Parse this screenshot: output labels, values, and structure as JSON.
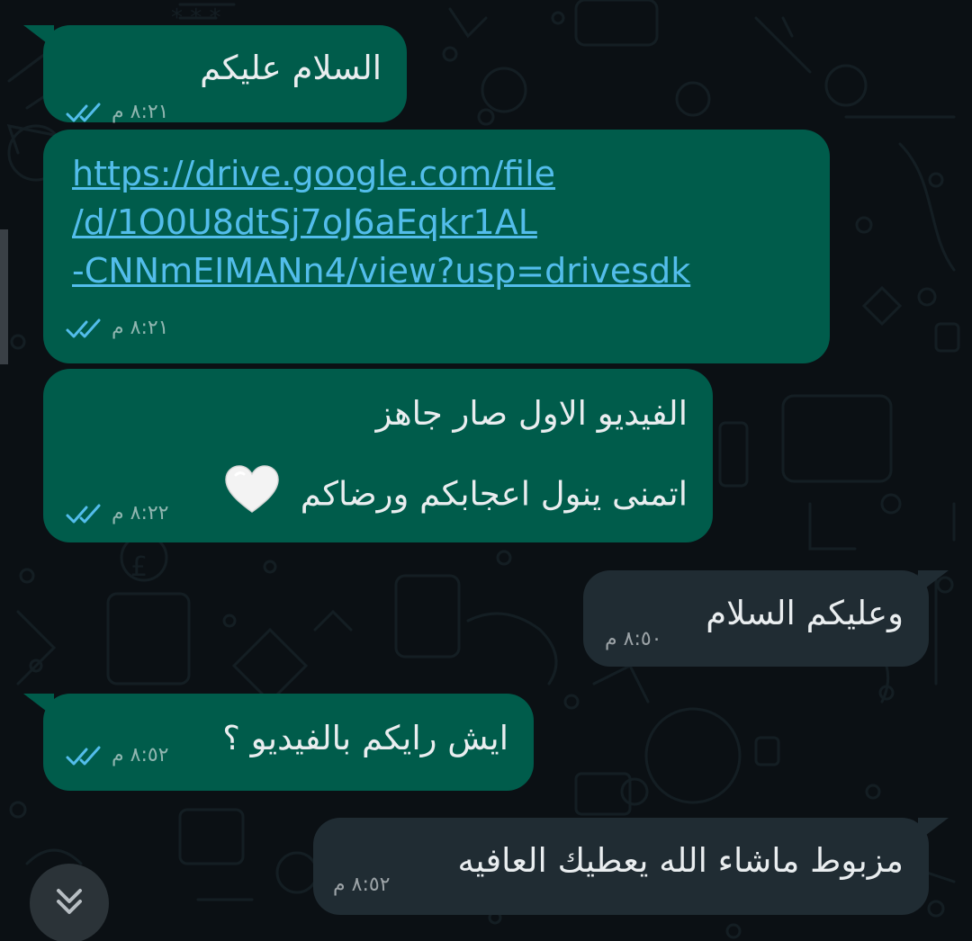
{
  "messages": [
    {
      "id": "m1",
      "direction": "outgoing",
      "text": "السلام عليكم",
      "time": "٨:٢١ م",
      "status": "read"
    },
    {
      "id": "m2",
      "direction": "outgoing",
      "link_lines": [
        "https://drive.google.com/file",
        "/d/1O0U8dtSj7oJ6aEqkr1AL",
        "-CNNmEIMANn4/view?usp=drivesdk"
      ],
      "time": "٨:٢١ م",
      "status": "read"
    },
    {
      "id": "m3",
      "direction": "outgoing",
      "lines": [
        "الفيديو الاول صار جاهز",
        "اتمنى ينول اعجابكم ورضاكم"
      ],
      "emoji": "white-heart",
      "time": "٨:٢٢ م",
      "status": "read"
    },
    {
      "id": "m4",
      "direction": "incoming",
      "text": "وعليكم السلام",
      "time": "٨:٥٠ م"
    },
    {
      "id": "m5",
      "direction": "outgoing",
      "text": "ايش رايكم بالفيديو ؟",
      "time": "٨:٥٢ م",
      "status": "read"
    },
    {
      "id": "m6",
      "direction": "incoming",
      "text": "مزبوط ماشاء الله يعطيك العافيه",
      "time": "٨:٥٢ م"
    }
  ],
  "icons": {
    "read_receipt": "double-check-icon",
    "scroll_down": "chevron-double-down-icon",
    "emoji": "white-heart-icon"
  },
  "colors": {
    "background": "#0b1014",
    "outgoing_bubble": "#005c4b",
    "incoming_bubble": "#202c33",
    "read_tick": "#53bdeb",
    "link": "#53bdeb",
    "text": "#e9edef"
  }
}
